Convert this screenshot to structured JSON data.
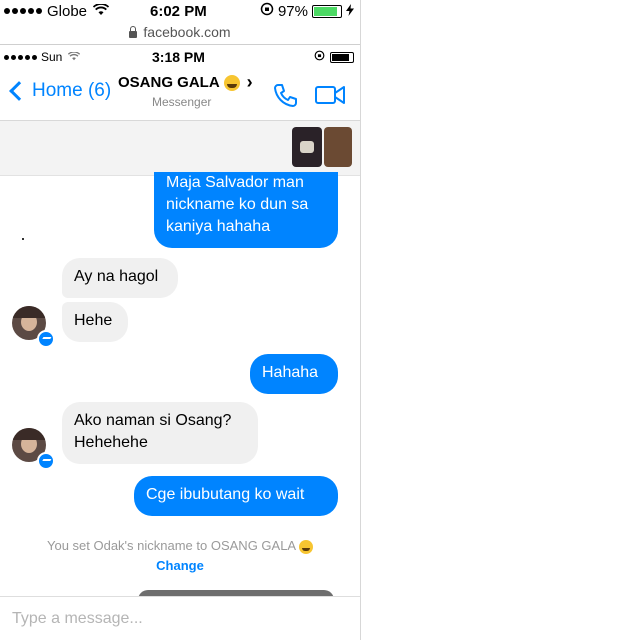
{
  "outer_status": {
    "carrier": "Globe",
    "time": "6:02 PM",
    "battery": "97%",
    "battery_level": 0.97
  },
  "browser": {
    "url": "facebook.com"
  },
  "inner_status": {
    "carrier": "Sun",
    "time": "3:18 PM"
  },
  "header": {
    "back_label": "Home (6)",
    "title": "OSANG GALA",
    "subtitle": "Messenger"
  },
  "messages": [
    {
      "direction": "outgoing",
      "text": "Maja Salvador man nickname ko dun sa kaniya hahaha"
    },
    {
      "direction": "incoming",
      "text": "Ay na hagol"
    },
    {
      "direction": "incoming",
      "text": "Hehe"
    },
    {
      "direction": "outgoing",
      "text": "Hahaha"
    },
    {
      "direction": "incoming",
      "text": "Ako naman si Osang? Hehehehe"
    },
    {
      "direction": "outgoing",
      "text": "Cge ibubutang ko wait"
    }
  ],
  "system": {
    "text": "You set Odak's nickname to OSANG GALA",
    "link": "Change"
  },
  "composer": {
    "placeholder": "Type a message..."
  },
  "colors": {
    "accent": "#0084ff",
    "incoming_bubble": "#f0f0f0",
    "battery_fill": "#4cd964"
  }
}
